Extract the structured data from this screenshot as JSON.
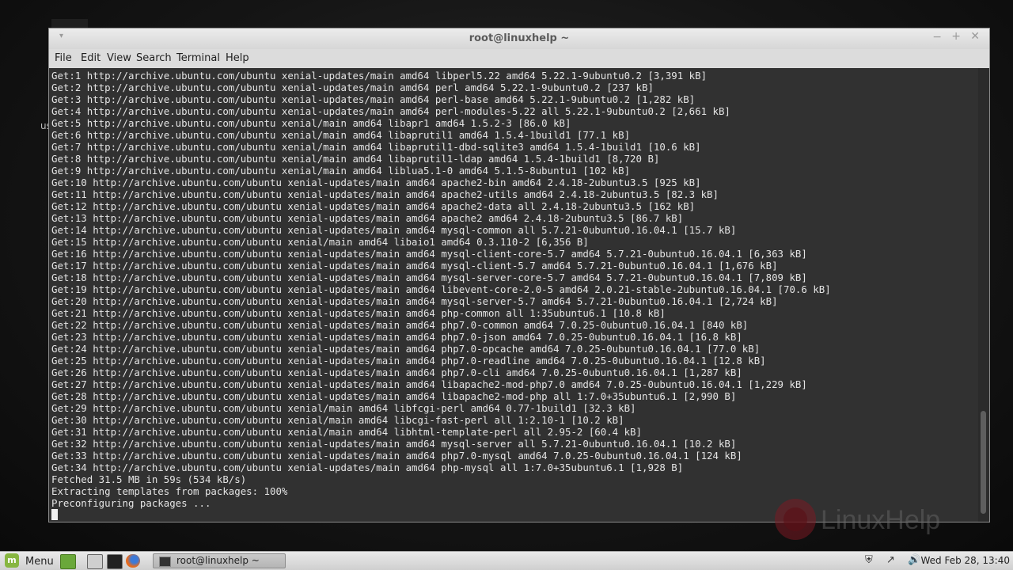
{
  "window": {
    "title": "root@linuxhelp ~",
    "controls": {
      "minimize": "−",
      "maximize": "+",
      "close": "✕",
      "menu": "▾"
    }
  },
  "menubar": [
    "File",
    "Edit",
    "View",
    "Search",
    "Terminal",
    "Help"
  ],
  "terminal": {
    "lines": [
      "Get:1 http://archive.ubuntu.com/ubuntu xenial-updates/main amd64 libperl5.22 amd64 5.22.1-9ubuntu0.2 [3,391 kB]",
      "Get:2 http://archive.ubuntu.com/ubuntu xenial-updates/main amd64 perl amd64 5.22.1-9ubuntu0.2 [237 kB]",
      "Get:3 http://archive.ubuntu.com/ubuntu xenial-updates/main amd64 perl-base amd64 5.22.1-9ubuntu0.2 [1,282 kB]",
      "Get:4 http://archive.ubuntu.com/ubuntu xenial-updates/main amd64 perl-modules-5.22 all 5.22.1-9ubuntu0.2 [2,661 kB]",
      "Get:5 http://archive.ubuntu.com/ubuntu xenial/main amd64 libapr1 amd64 1.5.2-3 [86.0 kB]",
      "Get:6 http://archive.ubuntu.com/ubuntu xenial/main amd64 libaprutil1 amd64 1.5.4-1build1 [77.1 kB]",
      "Get:7 http://archive.ubuntu.com/ubuntu xenial/main amd64 libaprutil1-dbd-sqlite3 amd64 1.5.4-1build1 [10.6 kB]",
      "Get:8 http://archive.ubuntu.com/ubuntu xenial/main amd64 libaprutil1-ldap amd64 1.5.4-1build1 [8,720 B]",
      "Get:9 http://archive.ubuntu.com/ubuntu xenial/main amd64 liblua5.1-0 amd64 5.1.5-8ubuntu1 [102 kB]",
      "Get:10 http://archive.ubuntu.com/ubuntu xenial-updates/main amd64 apache2-bin amd64 2.4.18-2ubuntu3.5 [925 kB]",
      "Get:11 http://archive.ubuntu.com/ubuntu xenial-updates/main amd64 apache2-utils amd64 2.4.18-2ubuntu3.5 [82.3 kB]",
      "Get:12 http://archive.ubuntu.com/ubuntu xenial-updates/main amd64 apache2-data all 2.4.18-2ubuntu3.5 [162 kB]",
      "Get:13 http://archive.ubuntu.com/ubuntu xenial-updates/main amd64 apache2 amd64 2.4.18-2ubuntu3.5 [86.7 kB]",
      "Get:14 http://archive.ubuntu.com/ubuntu xenial-updates/main amd64 mysql-common all 5.7.21-0ubuntu0.16.04.1 [15.7 kB]",
      "Get:15 http://archive.ubuntu.com/ubuntu xenial/main amd64 libaio1 amd64 0.3.110-2 [6,356 B]",
      "Get:16 http://archive.ubuntu.com/ubuntu xenial-updates/main amd64 mysql-client-core-5.7 amd64 5.7.21-0ubuntu0.16.04.1 [6,363 kB]",
      "Get:17 http://archive.ubuntu.com/ubuntu xenial-updates/main amd64 mysql-client-5.7 amd64 5.7.21-0ubuntu0.16.04.1 [1,676 kB]",
      "Get:18 http://archive.ubuntu.com/ubuntu xenial-updates/main amd64 mysql-server-core-5.7 amd64 5.7.21-0ubuntu0.16.04.1 [7,809 kB]",
      "Get:19 http://archive.ubuntu.com/ubuntu xenial-updates/main amd64 libevent-core-2.0-5 amd64 2.0.21-stable-2ubuntu0.16.04.1 [70.6 kB]",
      "Get:20 http://archive.ubuntu.com/ubuntu xenial-updates/main amd64 mysql-server-5.7 amd64 5.7.21-0ubuntu0.16.04.1 [2,724 kB]",
      "Get:21 http://archive.ubuntu.com/ubuntu xenial-updates/main amd64 php-common all 1:35ubuntu6.1 [10.8 kB]",
      "Get:22 http://archive.ubuntu.com/ubuntu xenial-updates/main amd64 php7.0-common amd64 7.0.25-0ubuntu0.16.04.1 [840 kB]",
      "Get:23 http://archive.ubuntu.com/ubuntu xenial-updates/main amd64 php7.0-json amd64 7.0.25-0ubuntu0.16.04.1 [16.8 kB]",
      "Get:24 http://archive.ubuntu.com/ubuntu xenial-updates/main amd64 php7.0-opcache amd64 7.0.25-0ubuntu0.16.04.1 [77.0 kB]",
      "Get:25 http://archive.ubuntu.com/ubuntu xenial-updates/main amd64 php7.0-readline amd64 7.0.25-0ubuntu0.16.04.1 [12.8 kB]",
      "Get:26 http://archive.ubuntu.com/ubuntu xenial-updates/main amd64 php7.0-cli amd64 7.0.25-0ubuntu0.16.04.1 [1,287 kB]",
      "Get:27 http://archive.ubuntu.com/ubuntu xenial-updates/main amd64 libapache2-mod-php7.0 amd64 7.0.25-0ubuntu0.16.04.1 [1,229 kB]",
      "Get:28 http://archive.ubuntu.com/ubuntu xenial-updates/main amd64 libapache2-mod-php all 1:7.0+35ubuntu6.1 [2,990 B]",
      "Get:29 http://archive.ubuntu.com/ubuntu xenial/main amd64 libfcgi-perl amd64 0.77-1build1 [32.3 kB]",
      "Get:30 http://archive.ubuntu.com/ubuntu xenial/main amd64 libcgi-fast-perl all 1:2.10-1 [10.2 kB]",
      "Get:31 http://archive.ubuntu.com/ubuntu xenial/main amd64 libhtml-template-perl all 2.95-2 [60.4 kB]",
      "Get:32 http://archive.ubuntu.com/ubuntu xenial-updates/main amd64 mysql-server all 5.7.21-0ubuntu0.16.04.1 [10.2 kB]",
      "Get:33 http://archive.ubuntu.com/ubuntu xenial-updates/main amd64 php7.0-mysql amd64 7.0.25-0ubuntu0.16.04.1 [124 kB]",
      "Get:34 http://archive.ubuntu.com/ubuntu xenial-updates/main amd64 php-mysql all 1:7.0+35ubuntu6.1 [1,928 B]",
      "Fetched 31.5 MB in 59s (534 kB/s)",
      "Extracting templates from packages: 100%",
      "Preconfiguring packages ..."
    ],
    "background": "#313131",
    "foreground": "#e4e4e4"
  },
  "desktop": {
    "partial_text": "us"
  },
  "watermark": {
    "text": "LinuxHelp"
  },
  "taskbar": {
    "menu_label": "Menu",
    "menu_logo": "m",
    "launchers": [
      "show-desktop-icon",
      "file-manager-icon",
      "terminal-icon",
      "firefox-icon"
    ],
    "task_label": "root@linuxhelp ~",
    "tray_icons": [
      "shield-icon",
      "network-icon",
      "volume-icon"
    ],
    "clock": "Wed Feb 28, 13:40"
  }
}
